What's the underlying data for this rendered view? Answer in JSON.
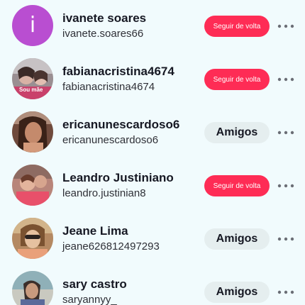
{
  "users": [
    {
      "name": "ivanete soares",
      "handle": "ivanete.soares66",
      "button": "Seguir de volta",
      "avatar_letter": "i",
      "avatar_color": "#b94ed1"
    },
    {
      "name": "fabianacristina4674",
      "handle": "fabianacristina4674",
      "button": "Seguir de volta",
      "avatar_badge": "Sou mãe"
    },
    {
      "name": "ericanunescardoso6",
      "handle": "ericanunescardoso6",
      "button": "Amigos"
    },
    {
      "name": "Leandro Justiniano",
      "handle": "leandro.justinian8",
      "button": "Seguir de volta"
    },
    {
      "name": "Jeane Lima",
      "handle": "jeane626812497293",
      "button": "Amigos"
    },
    {
      "name": "sary castro",
      "handle": "saryannyy_",
      "button": "Amigos"
    }
  ],
  "colors": {
    "follow_button": "#fe2c55",
    "friends_button": "#e5eeef",
    "background": "#f1fbfd"
  },
  "icons": {
    "more": "more-horizontal-icon"
  }
}
